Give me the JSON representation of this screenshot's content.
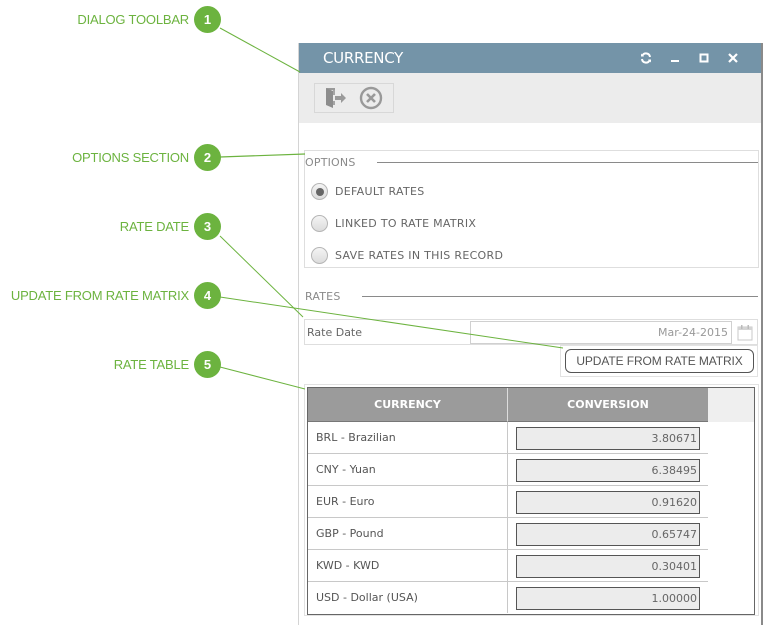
{
  "callouts": [
    {
      "number": "1",
      "label": "DIALOG TOOLBAR"
    },
    {
      "number": "2",
      "label": "OPTIONS SECTION"
    },
    {
      "number": "3",
      "label": "RATE DATE"
    },
    {
      "number": "4",
      "label": "UPDATE FROM RATE MATRIX"
    },
    {
      "number": "5",
      "label": "RATE TABLE"
    }
  ],
  "dialog": {
    "title": "CURRENCY",
    "window_icons": [
      "refresh-icon",
      "minimize-icon",
      "maximize-icon",
      "close-icon"
    ],
    "toolbar": {
      "buttons": [
        {
          "icon": "exit-door-icon",
          "label": "Exit"
        },
        {
          "icon": "cancel-circle-x-icon",
          "label": "Cancel"
        }
      ]
    },
    "options": {
      "heading": "OPTIONS",
      "items": [
        {
          "label": "DEFAULT RATES",
          "selected": true
        },
        {
          "label": "LINKED TO RATE MATRIX",
          "selected": false
        },
        {
          "label": "SAVE RATES IN THIS RECORD",
          "selected": false
        }
      ]
    },
    "rates": {
      "heading": "RATES",
      "rate_date_label": "Rate Date",
      "rate_date_value": "Mar-24-2015",
      "update_button": "UPDATE FROM RATE MATRIX",
      "table": {
        "columns": [
          "CURRENCY",
          "CONVERSION"
        ],
        "rows": [
          {
            "currency": "BRL - Brazilian",
            "conversion": "3.80671"
          },
          {
            "currency": "CNY - Yuan",
            "conversion": "6.38495"
          },
          {
            "currency": "EUR - Euro",
            "conversion": "0.91620"
          },
          {
            "currency": "GBP - Pound",
            "conversion": "0.65747"
          },
          {
            "currency": "KWD - KWD",
            "conversion": "0.30401"
          },
          {
            "currency": "USD - Dollar (USA)",
            "conversion": "1.00000"
          }
        ]
      }
    }
  },
  "colors": {
    "callout_green": "#6cb33f",
    "titlebar": "#7494a8",
    "toolbar_bg": "#ececec",
    "table_header": "#9b9b9b"
  }
}
